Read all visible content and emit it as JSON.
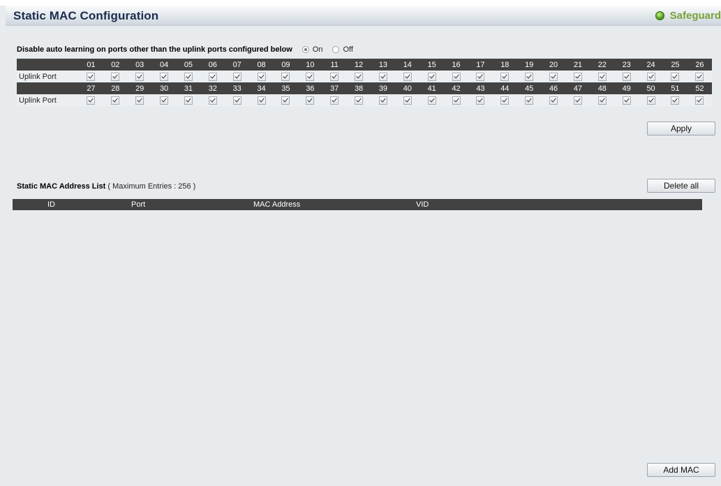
{
  "header": {
    "title": "Static MAC Configuration",
    "brand": "Safeguard",
    "brand_color": "#7ba23a"
  },
  "auto_learning": {
    "label": "Disable auto learning on ports other than the uplink ports configured below",
    "option_on": "On",
    "option_off": "Off",
    "selected": "On"
  },
  "uplink": {
    "row_label": "Uplink Port",
    "ports_row1": [
      "01",
      "02",
      "03",
      "04",
      "05",
      "06",
      "07",
      "08",
      "09",
      "10",
      "11",
      "12",
      "13",
      "14",
      "15",
      "16",
      "17",
      "18",
      "19",
      "20",
      "21",
      "22",
      "23",
      "24",
      "25",
      "26"
    ],
    "ports_row2": [
      "27",
      "28",
      "29",
      "30",
      "31",
      "32",
      "33",
      "34",
      "35",
      "36",
      "37",
      "38",
      "39",
      "40",
      "41",
      "42",
      "43",
      "44",
      "45",
      "46",
      "47",
      "48",
      "49",
      "50",
      "51",
      "52"
    ],
    "all_checked": true
  },
  "buttons": {
    "apply": "Apply",
    "delete_all": "Delete all",
    "add_mac": "Add MAC"
  },
  "static_list": {
    "title": "Static MAC Address List",
    "meta": "( Maximum Entries : 256 )",
    "columns": [
      "ID",
      "Port",
      "MAC Address",
      "VID"
    ]
  }
}
